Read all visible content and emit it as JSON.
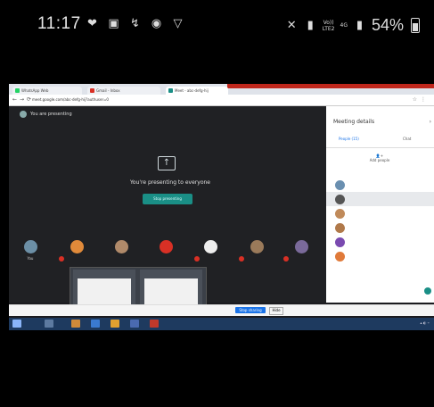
{
  "phone_status": {
    "time": "11:17",
    "carrier_top": "Vo))",
    "carrier_bottom": "LTE2",
    "network": "4G",
    "battery": "54%"
  },
  "browser": {
    "tabs": [
      {
        "label": "WhatsApp Web",
        "color": "#25d366"
      },
      {
        "label": "Gmail - Inbox",
        "color": "#d93025"
      },
      {
        "label": "Meet - abc-defg-hij",
        "color": "#1a8f86"
      }
    ],
    "url": "meet.google.com/abc-defg-hij?authuser=0"
  },
  "meet": {
    "presenting_label": "You are presenting",
    "presenting_message": "You're presenting to everyone",
    "stop_button": "Stop presenting",
    "participants": [
      {
        "name": "You",
        "color": "#6c8fa6"
      },
      {
        "name": "",
        "color": "#e08a3a"
      },
      {
        "name": "",
        "color": "#b08a6a"
      },
      {
        "name": "",
        "color": "#d93025"
      },
      {
        "name": "",
        "color": "#eeeeee"
      },
      {
        "name": "",
        "color": "#9a7a5a"
      },
      {
        "name": "",
        "color": "#7a6a9a"
      }
    ]
  },
  "panel": {
    "title": "Meeting details",
    "tab_people": "People (15)",
    "tab_chat": "Chat",
    "add_people": "Add people",
    "people": [
      {
        "name": "",
        "color": "#6a8fb0"
      },
      {
        "name": "",
        "color": "#555555",
        "highlight": true
      },
      {
        "name": "",
        "color": "#c08a5a"
      },
      {
        "name": "",
        "color": "#b0794a"
      },
      {
        "name": "",
        "color": "#7a4ab0"
      },
      {
        "name": "",
        "color": "#e07a3a"
      }
    ],
    "notice": ""
  },
  "popup": {
    "thumb1_title": "",
    "thumb2_title": ""
  },
  "notification": {
    "text": "",
    "share_button": "Stop sharing",
    "hide_button": "Hide"
  }
}
